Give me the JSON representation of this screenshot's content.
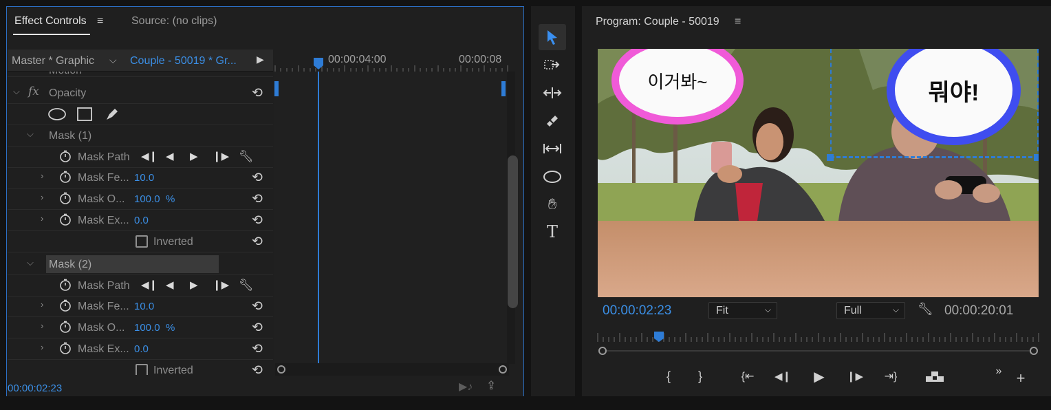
{
  "effect_controls": {
    "tab_title": "Effect Controls",
    "tab_menu": "≡",
    "source_tab": "Source: (no clips)",
    "master_label": "Master * Graphic",
    "clip_label": "Couple - 50019 * Gr...",
    "ruler_times": [
      "00:00:04:00",
      "00:00:08"
    ],
    "timecode": "00:00:02:23",
    "motion_label": "Motion",
    "opacity_label": "Opacity",
    "mask1": {
      "title": "Mask (1)",
      "path_label": "Mask Path",
      "feather_label": "Mask Fe...",
      "feather_value": "10.0",
      "opacity_label": "Mask O...",
      "opacity_value": "100.0",
      "opacity_unit": "%",
      "expansion_label": "Mask Ex...",
      "expansion_value": "0.0",
      "inverted_label": "Inverted"
    },
    "mask2": {
      "title": "Mask (2)",
      "path_label": "Mask Path",
      "feather_label": "Mask Fe...",
      "feather_value": "10.0",
      "opacity_label": "Mask O...",
      "opacity_value": "100.0",
      "opacity_unit": "%",
      "expansion_label": "Mask Ex...",
      "expansion_value": "0.0",
      "inverted_label": "Inverted"
    }
  },
  "program_monitor": {
    "title": "Program: Couple - 50019",
    "menu": "≡",
    "timecode": "00:00:02:23",
    "zoom": "Fit",
    "resolution": "Full",
    "duration": "00:00:20:01",
    "bubble_left_text": "이거봐~",
    "bubble_right_text": "뭐야!",
    "playhead_fraction": 0.14
  },
  "colors": {
    "accent": "#2e7cd6",
    "timecode": "#3b8fe6",
    "bubble_pink": "#f05ad8",
    "bubble_blue": "#3f4df0"
  }
}
